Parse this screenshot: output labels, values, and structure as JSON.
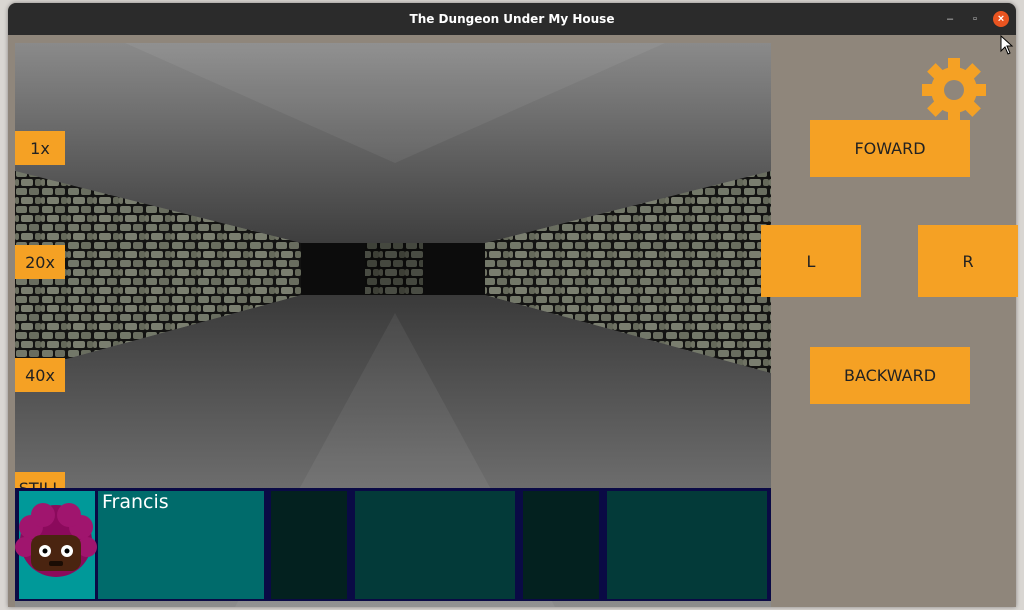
{
  "window": {
    "title": "The Dungeon Under My House"
  },
  "speed_buttons": [
    "1x",
    "20x",
    "40x",
    "STILL"
  ],
  "party": {
    "members": [
      {
        "name": "Francis"
      }
    ]
  },
  "controls": {
    "forward": "FOWARD",
    "left": "L",
    "right": "R",
    "backward": "BACKWARD"
  },
  "icons": {
    "settings": "gear-icon",
    "avatar": "character-portrait"
  },
  "colors": {
    "button": "#f5a124",
    "panel": "#8f867b",
    "party_bg": "#0a0a45",
    "slot_active": "#009999",
    "slot_bar": "#006b6b"
  }
}
